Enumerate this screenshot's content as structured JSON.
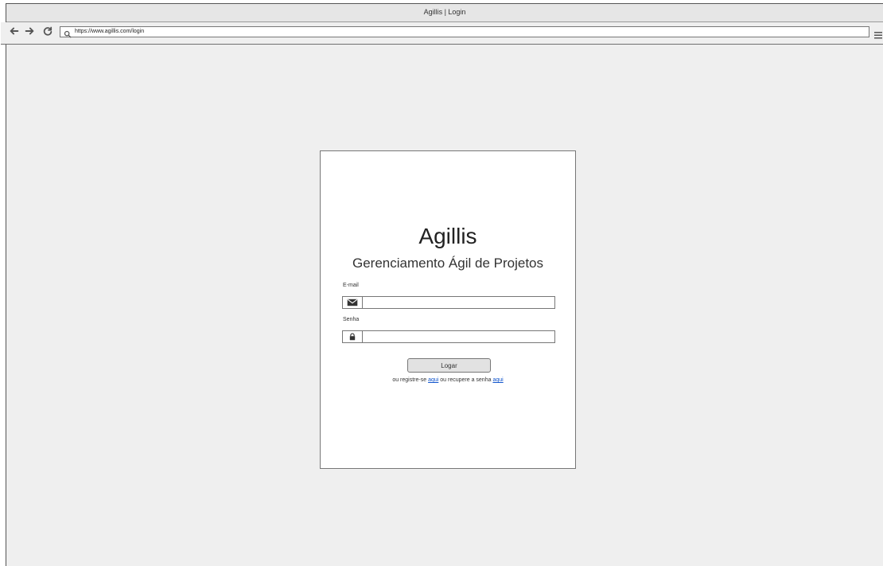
{
  "browser": {
    "title": "Agillis | Login",
    "url": "https://www.agillis.com/login"
  },
  "login": {
    "brand": "Agillis",
    "subtitle": "Gerenciamento Ágil de Projetos",
    "email_label": "E-mail",
    "email_value": "",
    "password_label": "Senha",
    "password_value": "",
    "button_label": "Logar",
    "register_text": "ou registre-se",
    "register_link": "aqui",
    "recover_text": "ou recupere a senha",
    "recover_link": "aqui"
  },
  "icons": {
    "back": "arrow-left-icon",
    "forward": "arrow-right-icon",
    "reload": "reload-icon",
    "search": "search-icon",
    "menu": "hamburger-menu-icon",
    "email": "envelope-icon",
    "password": "lock-icon"
  },
  "colors": {
    "background": "#efefef",
    "card": "#ffffff",
    "link": "#1155cc"
  }
}
